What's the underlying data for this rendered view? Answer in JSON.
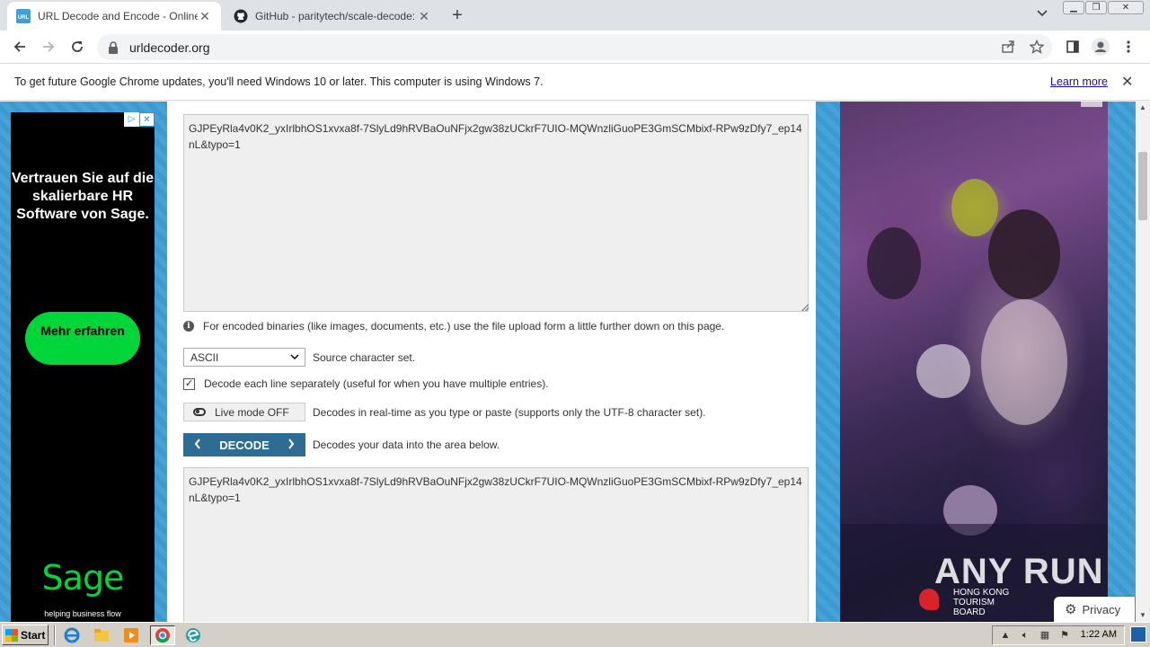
{
  "browser": {
    "tabs": [
      {
        "title": "URL Decode and Encode - Online",
        "favicon": "urldecoder-favicon",
        "active": true
      },
      {
        "title": "GitHub - paritytech/scale-decode: De",
        "favicon": "github-icon",
        "active": false
      }
    ],
    "url": "urldecoder.org",
    "infobar": {
      "message": "To get future Google Chrome updates, you'll need Windows 10 or later. This computer is using Windows 7.",
      "link": "Learn more"
    }
  },
  "left_ad": {
    "headline": "Vertrauen Sie auf die skalierbare HR Software von Sage.",
    "cta": "Mehr erfahren",
    "logo": "Sage",
    "tagline": "helping business flow",
    "brand_color": "#00d639"
  },
  "main": {
    "input_text": "GJPEyRla4v0K2_yxIrlbhOS1xvxa8f-7SlyLd9hRVBaOuNFjx2gw38zUCkrF7UIO-MQWnzliGuoPE3GmSCMbixf-RPw9zDfy7_ep14nL&typo=1",
    "upload_note": "For encoded binaries (like images, documents, etc.) use the file upload form a little further down on this page.",
    "charset": {
      "selected": "ASCII",
      "label": "Source character set."
    },
    "decode_lines": {
      "checked": true,
      "label": "Decode each line separately (useful for when you have multiple entries)."
    },
    "live_mode": {
      "button": "Live mode OFF",
      "label": "Decodes in real-time as you type or paste (supports only the UTF-8 character set)."
    },
    "decode": {
      "button": "DECODE",
      "label": "Decodes your data into the area below."
    },
    "output_text": "GJPEyRla4v0K2_yxIrlbhOS1xvxa8f-7SlyLd9hRVBaOuNFjx2gw38zUCkrF7UIO-MQWnzliGuoPE3GmSCMbixf-RPw9zDfy7_ep14nL&typo=1",
    "accent_color": "#2f6c93",
    "background_color": "#3f9fd8"
  },
  "right_ad": {
    "brand": "HONG KONG TOURISM BOARD"
  },
  "overlay": {
    "watermark": "ANY RUN",
    "privacy": "Privacy"
  },
  "taskbar": {
    "start": "Start",
    "clock": "1:22 AM"
  }
}
